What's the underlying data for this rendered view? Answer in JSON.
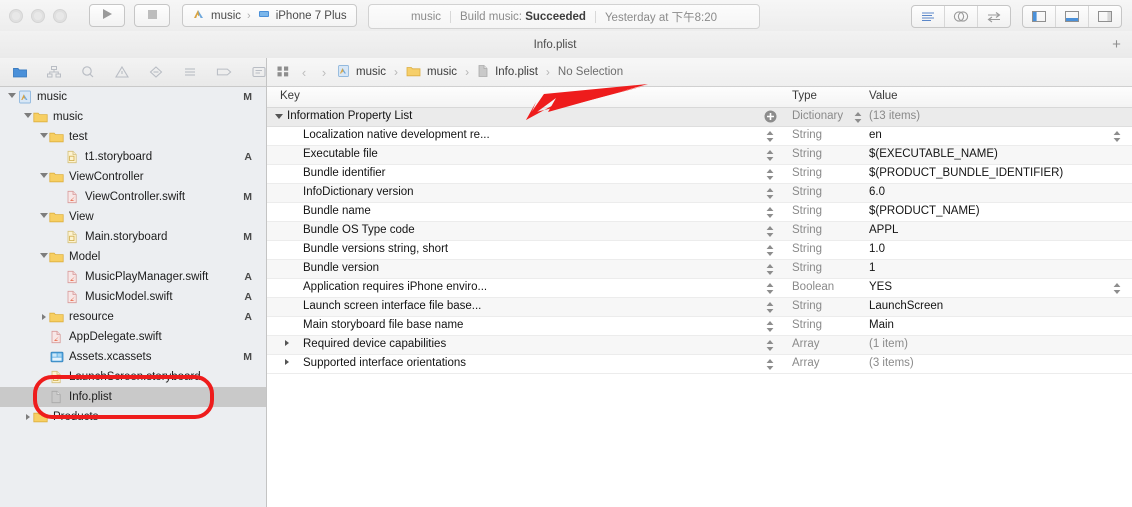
{
  "toolbar": {
    "run_icon": "play-icon",
    "stop_icon": "stop-icon",
    "scheme_project": "music",
    "scheme_device": "iPhone 7 Plus",
    "scheme_sep": "›",
    "editor_buttons": [
      "standard-editor-icon",
      "assistant-editor-icon",
      "version-editor-icon"
    ],
    "view_buttons": [
      "navigator-toggle-icon",
      "debug-toggle-icon",
      "utilities-toggle-icon"
    ]
  },
  "status": {
    "project": "music",
    "activity": "Build music:",
    "result": "Succeeded",
    "time": "Yesterday at 下午8:20"
  },
  "tabbar": {
    "active_tab": "Info.plist",
    "add_label": "+"
  },
  "navigator": {
    "tabs": [
      "project-navigator-icon",
      "source-control-navigator-icon",
      "find-navigator-icon",
      "issue-navigator-icon",
      "test-navigator-icon",
      "debug-navigator-icon",
      "breakpoint-navigator-icon",
      "report-navigator-icon"
    ],
    "items": [
      {
        "label": "music",
        "icon": "xcode-project-icon",
        "indent": 0,
        "twisty": "open",
        "badge": "M",
        "selected": false
      },
      {
        "label": "music",
        "icon": "folder-icon",
        "indent": 1,
        "twisty": "open",
        "badge": "",
        "selected": false
      },
      {
        "label": "test",
        "icon": "folder-icon",
        "indent": 2,
        "twisty": "open",
        "badge": "",
        "selected": false
      },
      {
        "label": "t1.storyboard",
        "icon": "storyboard-icon",
        "indent": 3,
        "twisty": "none",
        "badge": "A",
        "selected": false
      },
      {
        "label": "ViewController",
        "icon": "folder-icon",
        "indent": 2,
        "twisty": "open",
        "badge": "",
        "selected": false
      },
      {
        "label": "ViewController.swift",
        "icon": "swift-icon",
        "indent": 3,
        "twisty": "none",
        "badge": "M",
        "selected": false
      },
      {
        "label": "View",
        "icon": "folder-icon",
        "indent": 2,
        "twisty": "open",
        "badge": "",
        "selected": false
      },
      {
        "label": "Main.storyboard",
        "icon": "storyboard-icon",
        "indent": 3,
        "twisty": "none",
        "badge": "M",
        "selected": false
      },
      {
        "label": "Model",
        "icon": "folder-icon",
        "indent": 2,
        "twisty": "open",
        "badge": "",
        "selected": false
      },
      {
        "label": "MusicPlayManager.swift",
        "icon": "swift-icon",
        "indent": 3,
        "twisty": "none",
        "badge": "A",
        "selected": false
      },
      {
        "label": "MusicModel.swift",
        "icon": "swift-icon",
        "indent": 3,
        "twisty": "none",
        "badge": "A",
        "selected": false
      },
      {
        "label": "resource",
        "icon": "folder-icon",
        "indent": 2,
        "twisty": "closed",
        "badge": "A",
        "selected": false
      },
      {
        "label": "AppDelegate.swift",
        "icon": "swift-icon",
        "indent": 2,
        "twisty": "none",
        "badge": "",
        "selected": false
      },
      {
        "label": "Assets.xcassets",
        "icon": "assets-icon",
        "indent": 2,
        "twisty": "none",
        "badge": "M",
        "selected": false
      },
      {
        "label": "LaunchScreen.storyboard",
        "icon": "storyboard-icon",
        "indent": 2,
        "twisty": "none",
        "badge": "",
        "selected": false
      },
      {
        "label": "Info.plist",
        "icon": "plist-icon",
        "indent": 2,
        "twisty": "none",
        "badge": "",
        "selected": true
      },
      {
        "label": "Products",
        "icon": "folder-icon",
        "indent": 1,
        "twisty": "closed",
        "badge": "",
        "selected": false
      }
    ]
  },
  "breadcrumb": {
    "grid_icon": "related-files-icon",
    "back_icon": "‹",
    "forward_icon": "›",
    "sep": "›",
    "items": [
      {
        "label": "music",
        "icon": "xcode-project-icon"
      },
      {
        "label": "music",
        "icon": "folder-icon"
      },
      {
        "label": "Info.plist",
        "icon": "plist-icon"
      }
    ],
    "selection": "No Selection"
  },
  "plist": {
    "columns": {
      "key": "Key",
      "type": "Type",
      "value": "Value"
    },
    "rows": [
      {
        "key": "Information Property List",
        "type": "Dictionary",
        "value": "(13 items)",
        "indent": 0,
        "twisty": "open",
        "dim_value": true,
        "add": true,
        "stepper": false,
        "right_stepper": false
      },
      {
        "key": "Localization native development re...",
        "type": "String",
        "value": "en",
        "indent": 1,
        "twisty": "none",
        "dim_value": false,
        "add": false,
        "stepper": true,
        "right_stepper": true
      },
      {
        "key": "Executable file",
        "type": "String",
        "value": "$(EXECUTABLE_NAME)",
        "indent": 1,
        "twisty": "none",
        "dim_value": false,
        "add": false,
        "stepper": true,
        "right_stepper": false
      },
      {
        "key": "Bundle identifier",
        "type": "String",
        "value": "$(PRODUCT_BUNDLE_IDENTIFIER)",
        "indent": 1,
        "twisty": "none",
        "dim_value": false,
        "add": false,
        "stepper": true,
        "right_stepper": false
      },
      {
        "key": "InfoDictionary version",
        "type": "String",
        "value": "6.0",
        "indent": 1,
        "twisty": "none",
        "dim_value": false,
        "add": false,
        "stepper": true,
        "right_stepper": false
      },
      {
        "key": "Bundle name",
        "type": "String",
        "value": "$(PRODUCT_NAME)",
        "indent": 1,
        "twisty": "none",
        "dim_value": false,
        "add": false,
        "stepper": true,
        "right_stepper": false
      },
      {
        "key": "Bundle OS Type code",
        "type": "String",
        "value": "APPL",
        "indent": 1,
        "twisty": "none",
        "dim_value": false,
        "add": false,
        "stepper": true,
        "right_stepper": false
      },
      {
        "key": "Bundle versions string, short",
        "type": "String",
        "value": "1.0",
        "indent": 1,
        "twisty": "none",
        "dim_value": false,
        "add": false,
        "stepper": true,
        "right_stepper": false
      },
      {
        "key": "Bundle version",
        "type": "String",
        "value": "1",
        "indent": 1,
        "twisty": "none",
        "dim_value": false,
        "add": false,
        "stepper": true,
        "right_stepper": false
      },
      {
        "key": "Application requires iPhone enviro...",
        "type": "Boolean",
        "value": "YES",
        "indent": 1,
        "twisty": "none",
        "dim_value": false,
        "add": false,
        "stepper": true,
        "right_stepper": true
      },
      {
        "key": "Launch screen interface file base...",
        "type": "String",
        "value": "LaunchScreen",
        "indent": 1,
        "twisty": "none",
        "dim_value": false,
        "add": false,
        "stepper": true,
        "right_stepper": false
      },
      {
        "key": "Main storyboard file base name",
        "type": "String",
        "value": "Main",
        "indent": 1,
        "twisty": "none",
        "dim_value": false,
        "add": false,
        "stepper": true,
        "right_stepper": false
      },
      {
        "key": "Required device capabilities",
        "type": "Array",
        "value": "(1 item)",
        "indent": 1,
        "twisty": "closed",
        "dim_value": true,
        "add": false,
        "stepper": true,
        "right_stepper": false
      },
      {
        "key": "Supported interface orientations",
        "type": "Array",
        "value": "(3 items)",
        "indent": 1,
        "twisty": "closed",
        "dim_value": true,
        "add": false,
        "stepper": true,
        "right_stepper": false
      }
    ]
  },
  "annotations": {
    "highlight_color": "#ee1c1c",
    "box_target": "Info.plist",
    "arrow_target": "add-property-button"
  }
}
